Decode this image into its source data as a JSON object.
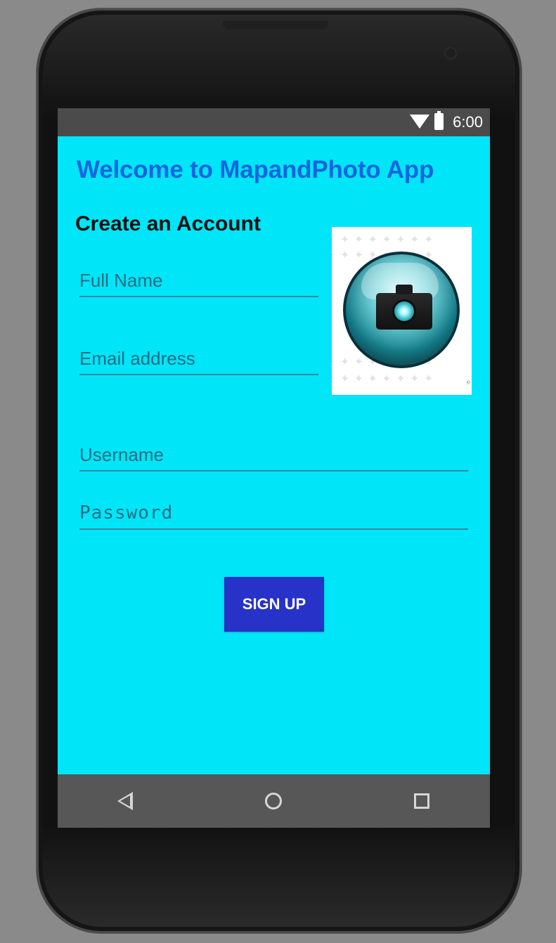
{
  "status_bar": {
    "time": "6:00",
    "icons": [
      "wifi-icon",
      "battery-icon"
    ]
  },
  "app": {
    "title": "Welcome to MapandPhoto App",
    "section_title": "Create an Account",
    "fields": {
      "full_name": {
        "value": "",
        "placeholder": "Full Name"
      },
      "email_address": {
        "value": "",
        "placeholder": "Email address"
      },
      "username": {
        "value": "",
        "placeholder": "Username"
      },
      "password": {
        "value": "",
        "placeholder": "Password"
      }
    },
    "image": {
      "icon": "camera-icon"
    },
    "signup_button": {
      "label": "SIGN UP"
    }
  },
  "navigation": {
    "items": [
      "back-icon",
      "home-icon",
      "recent-apps-icon"
    ]
  },
  "colors": {
    "screen_background": "#00e5f7",
    "title": "#1565e0",
    "button": "#2732c8",
    "status_bar": "#4b4b4b",
    "navigation_bar": "#575757"
  }
}
